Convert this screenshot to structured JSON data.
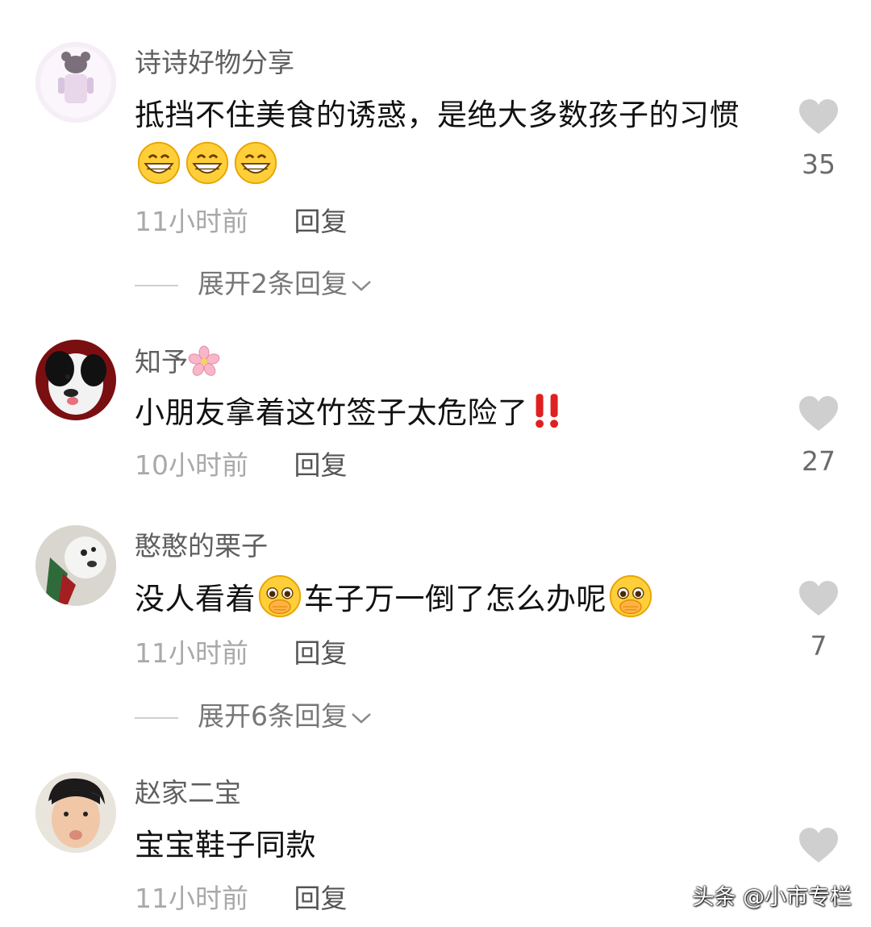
{
  "comments": [
    {
      "username": "诗诗好物分享",
      "text_part1": "抵挡不住美食的诱惑，是绝大多数孩子的习惯",
      "emoji": "grinning-face-icon",
      "time": "11小时前",
      "reply_label": "回复",
      "likes": "35",
      "expand_label": "展开2条回复"
    },
    {
      "username": "知予",
      "username_emoji": "cherry-blossom-icon",
      "text_part1": "小朋友拿着这竹签子太危险了",
      "emoji": "double-exclamation-icon",
      "time": "10小时前",
      "reply_label": "回复",
      "likes": "27"
    },
    {
      "username": "憨憨的栗子",
      "text_part1": "没人看着",
      "text_part2": "车子万一倒了怎么办呢",
      "emoji": "pleading-face-icon",
      "time": "11小时前",
      "reply_label": "回复",
      "likes": "7",
      "expand_label": "展开6条回复"
    },
    {
      "username": "赵家二宝",
      "text_part1": "宝宝鞋子同款",
      "time": "11小时前",
      "reply_label": "回复",
      "likes": ""
    }
  ],
  "watermark": "头条 @小市专栏",
  "colors": {
    "username": "#5f5f5f",
    "body_text": "#111111",
    "muted": "#a9a9a9",
    "heart": "#cfcfcf"
  }
}
